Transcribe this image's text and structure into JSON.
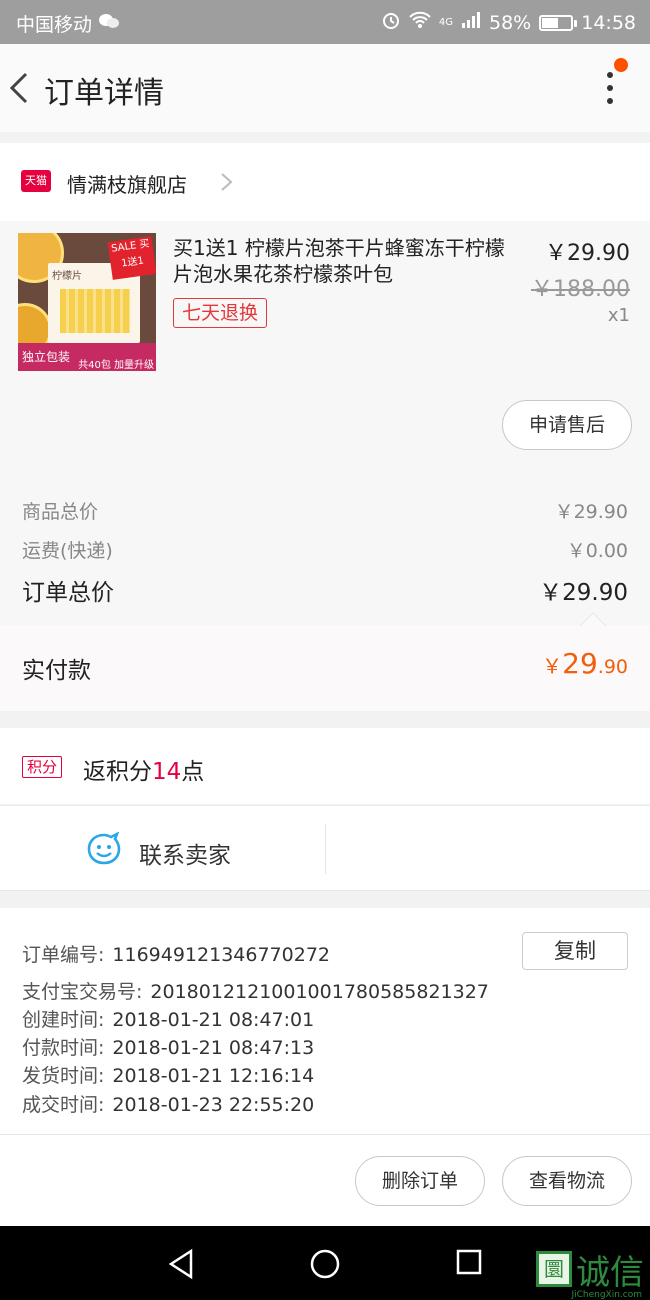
{
  "status_bar": {
    "carrier": "中国移动",
    "network": "4G",
    "battery": "58%",
    "battery_level": 0.58,
    "time": "14:58"
  },
  "nav": {
    "title": "订单详情"
  },
  "store": {
    "badge": "天猫",
    "name": "情满枝旗舰店"
  },
  "product": {
    "title": "买1送1 柠檬片泡茶干片蜂蜜冻干柠檬片泡水果花茶柠檬茶叶包",
    "tag": "七天退换",
    "price": "￥29.90",
    "original_price": "￥188.00",
    "quantity": "x1",
    "thumb_brand": "柠檬片",
    "thumb_sale": "SALE 买1送1",
    "thumb_bottom": "独立包装",
    "thumb_pkg": "共40包 加量升级",
    "after_sale_label": "申请售后"
  },
  "summary": {
    "goods_total_label": "商品总价",
    "goods_total": "￥29.90",
    "shipping_label": "运费(快递)",
    "shipping": "￥0.00",
    "order_total_label": "订单总价",
    "order_total": "￥29.90"
  },
  "paid": {
    "label": "实付款",
    "currency": "￥",
    "integer": "29",
    "decimal": ".90"
  },
  "points": {
    "badge": "积分",
    "prefix": "返积分",
    "value": "14",
    "suffix": "点"
  },
  "contact": {
    "label": "联系卖家"
  },
  "order_info": {
    "order_no_label": "订单编号:",
    "order_no": "116949121346770272",
    "alipay_label": "支付宝交易号:",
    "alipay_no": "2018012121001001780585821327",
    "created_label": "创建时间:",
    "created": "2018-01-21 08:47:01",
    "paid_label": "付款时间:",
    "paid": "2018-01-21 08:47:13",
    "shipped_label": "发货时间:",
    "shipped": "2018-01-21 12:16:14",
    "completed_label": "成交时间:",
    "completed": "2018-01-23 22:55:20",
    "copy_label": "复制"
  },
  "actions": {
    "delete_label": "删除订单",
    "logistics_label": "查看物流"
  },
  "watermark": {
    "box": "圜",
    "text": "诚信",
    "sub": "JiChengXin.com"
  },
  "colors": {
    "accent": "#f25e0a",
    "tmall_red": "#e5003f",
    "contact_blue": "#2aa7e8"
  }
}
